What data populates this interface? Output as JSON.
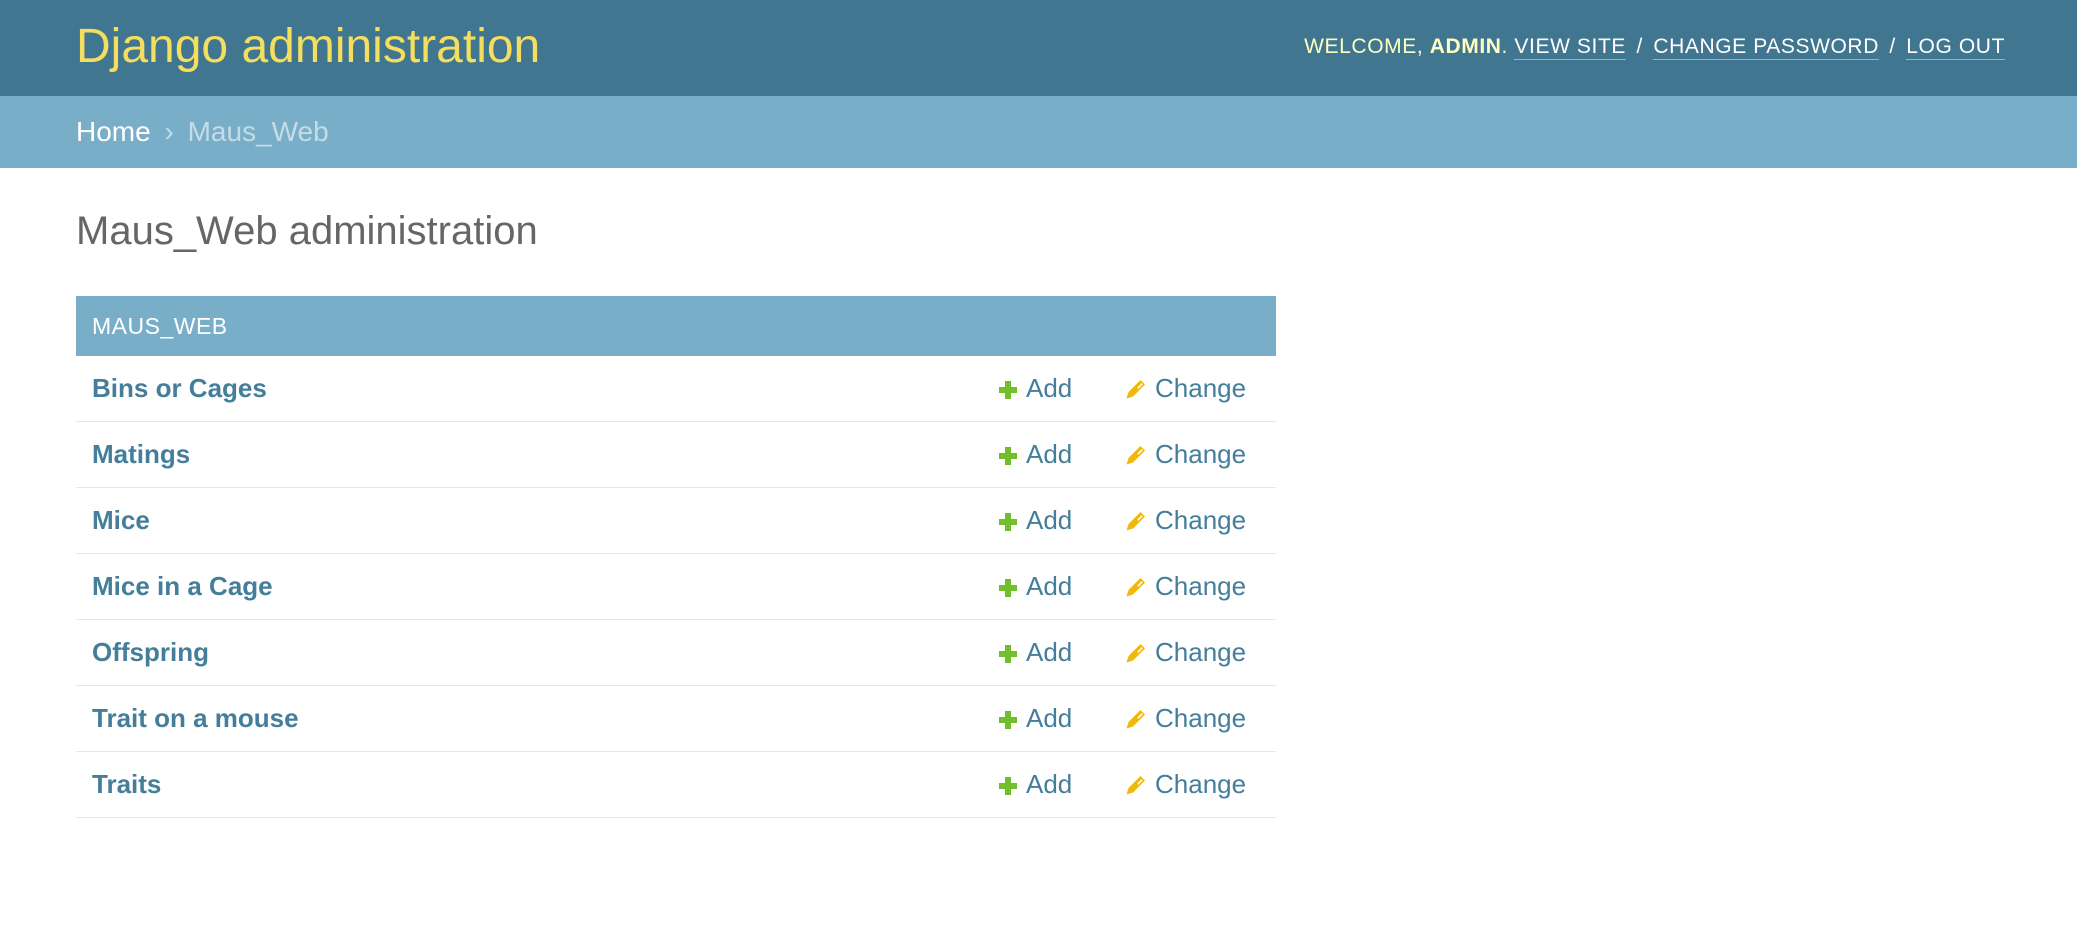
{
  "header": {
    "branding": "Django administration",
    "welcome": "Welcome,",
    "username": "admin",
    "after_username": ".",
    "view_site": "View site",
    "separator": "/",
    "change_password": "Change password",
    "log_out": "Log out"
  },
  "breadcrumbs": {
    "home": "Home",
    "separator": "›",
    "current": "Maus_Web"
  },
  "page": {
    "title": "Maus_Web administration"
  },
  "module": {
    "caption": "Maus_Web",
    "add_label": "Add",
    "change_label": "Change",
    "models": [
      {
        "name": "Bins or Cages"
      },
      {
        "name": "Matings"
      },
      {
        "name": "Mice"
      },
      {
        "name": "Mice in a Cage"
      },
      {
        "name": "Offspring"
      },
      {
        "name": "Trait on a mouse"
      },
      {
        "name": "Traits"
      }
    ]
  },
  "colors": {
    "header_bg": "#417690",
    "branding": "#f5dd5d",
    "breadcrumbs_bg": "#79aec8",
    "link": "#447e9b",
    "add_icon": "#70bf2b",
    "change_icon": "#efb80b"
  },
  "icons": {
    "add": "plus-icon",
    "change": "pencil-icon"
  }
}
